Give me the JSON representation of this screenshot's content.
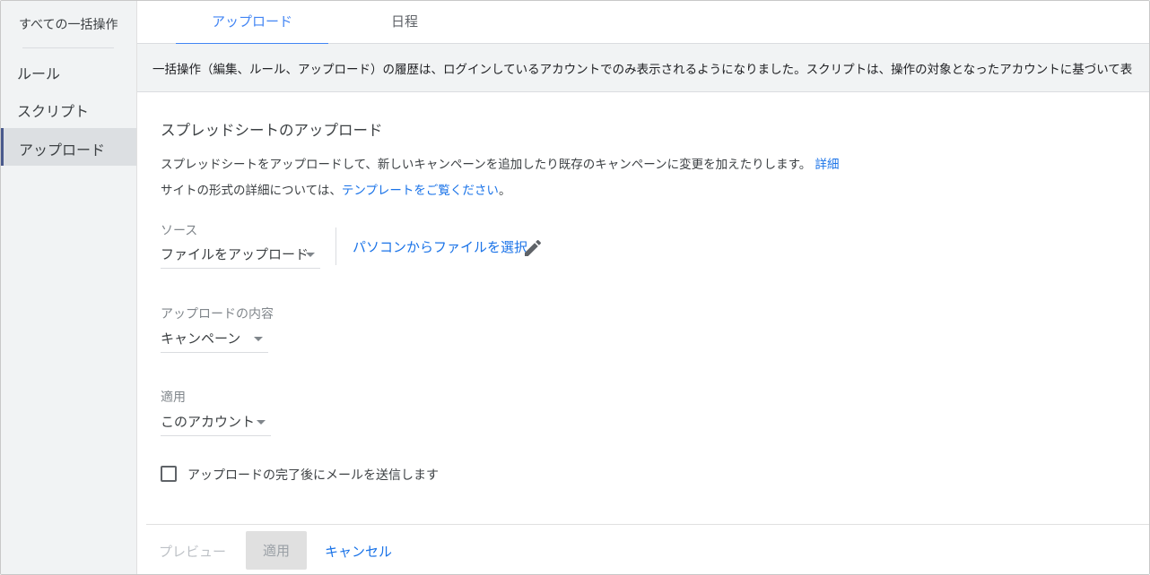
{
  "sidebar": {
    "header": "すべての一括操作",
    "items": [
      {
        "label": "ルール"
      },
      {
        "label": "スクリプト"
      },
      {
        "label": "アップロード"
      }
    ]
  },
  "tabs": [
    {
      "label": "アップロード",
      "active": true
    },
    {
      "label": "日程",
      "active": false
    }
  ],
  "banner": {
    "text": "一括操作（編集、ルール、アップロード）の履歴は、ログインしているアカウントでのみ表示されるようになりました。スクリプトは、操作の対象となったアカウントに基づいて表"
  },
  "main": {
    "title": "スプレッドシートのアップロード",
    "description1": "スプレッドシートをアップロードして、新しいキャンペーンを追加したり既存のキャンペーンに変更を加えたりします。",
    "description1_link": "詳細",
    "description2_prefix": "サイトの形式の詳細については、",
    "description2_link": "テンプレートをご覧ください",
    "description2_suffix": "。",
    "source": {
      "label": "ソース",
      "value": "ファイルをアップロード",
      "pc_link": "パソコンからファイルを選択"
    },
    "upload_content": {
      "label": "アップロードの内容",
      "value": "キャンペーン"
    },
    "apply_to": {
      "label": "適用",
      "value": "このアカウント"
    },
    "email_checkbox": {
      "label": "アップロードの完了後にメールを送信します",
      "checked": false
    }
  },
  "footer": {
    "preview": "プレビュー",
    "apply": "適用",
    "cancel": "キャンセル"
  },
  "colors": {
    "accent": "#1a73e8",
    "tab_active": "#4285f4",
    "sidebar_bg": "#f1f3f4",
    "sidebar_selected": "#dcdfe2"
  }
}
